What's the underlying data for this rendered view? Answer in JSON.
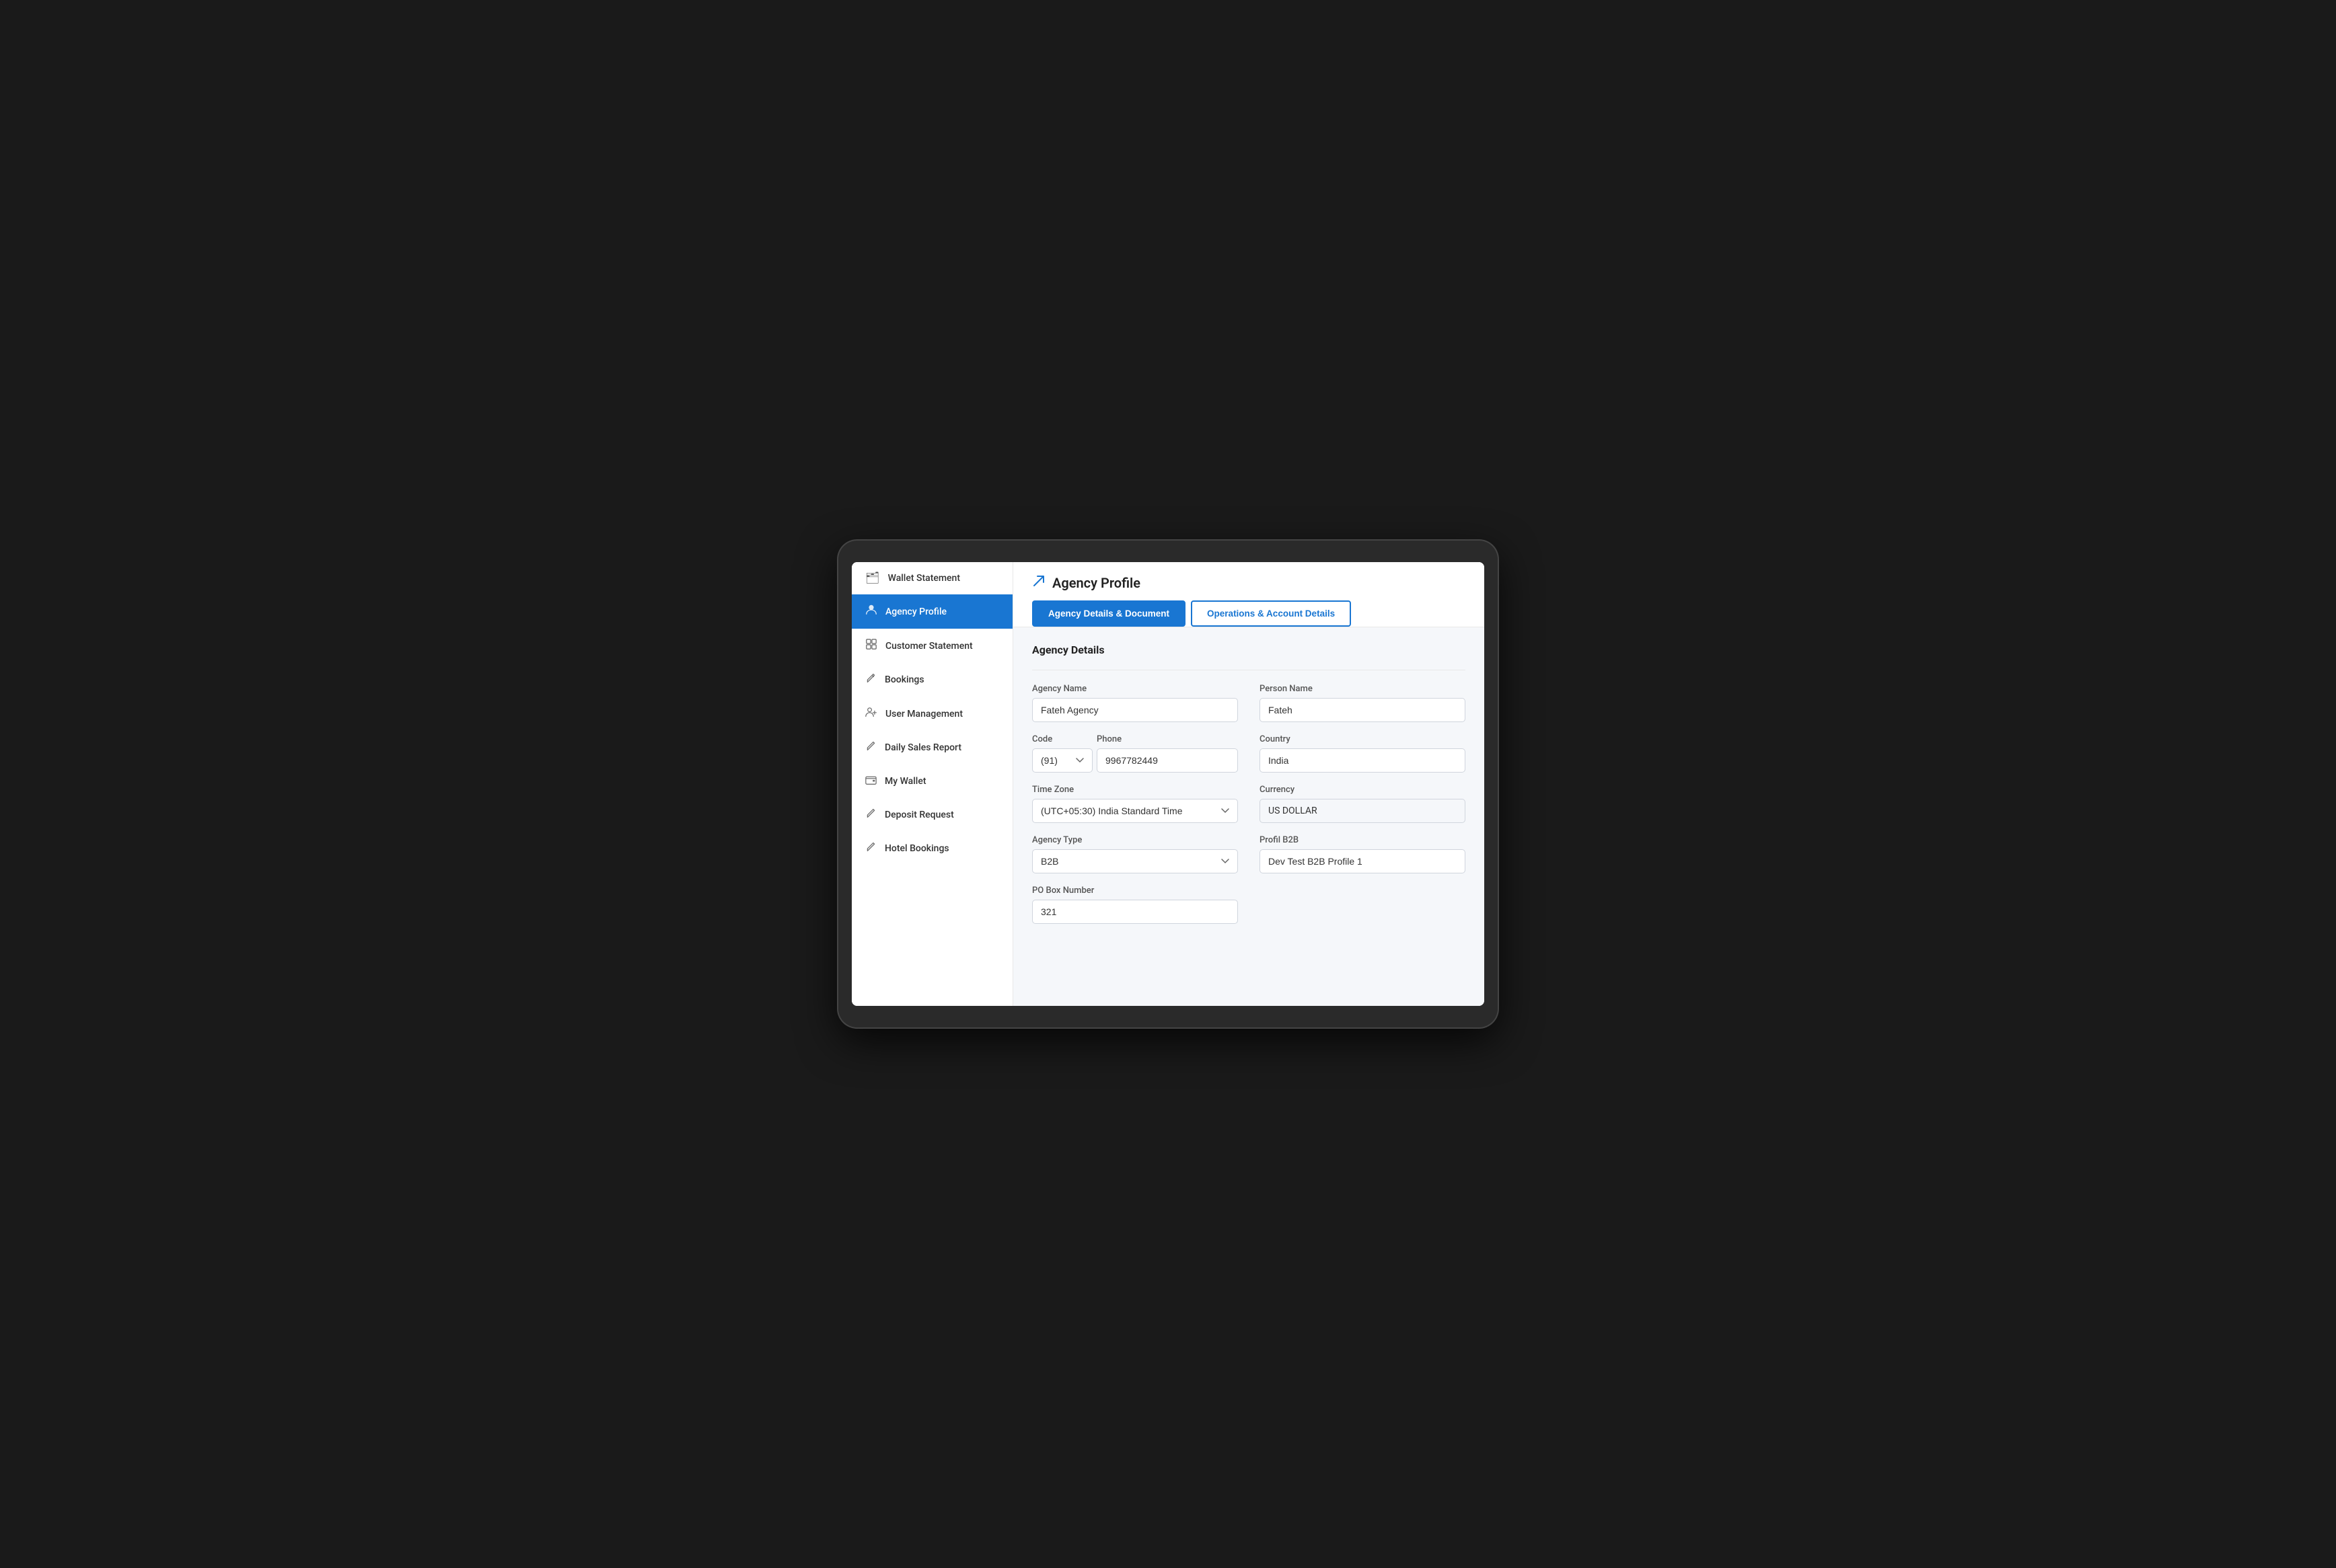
{
  "sidebar": {
    "items": [
      {
        "id": "wallet-statement",
        "label": "Wallet Statement",
        "icon": "🗂",
        "active": false
      },
      {
        "id": "agency-profile",
        "label": "Agency Profile",
        "icon": "👤",
        "active": true
      },
      {
        "id": "customer-statement",
        "label": "Customer Statement",
        "icon": "⊞",
        "active": false
      },
      {
        "id": "bookings",
        "label": "Bookings",
        "icon": "✏️",
        "active": false
      },
      {
        "id": "user-management",
        "label": "User Management",
        "icon": "👥",
        "active": false
      },
      {
        "id": "daily-sales-report",
        "label": "Daily Sales Report",
        "icon": "✏️",
        "active": false
      },
      {
        "id": "my-wallet",
        "label": "My Wallet",
        "icon": "💼",
        "active": false
      },
      {
        "id": "deposit-request",
        "label": "Deposit Request",
        "icon": "✏️",
        "active": false
      },
      {
        "id": "hotel-bookings",
        "label": "Hotel Bookings",
        "icon": "✏️",
        "active": false
      }
    ]
  },
  "header": {
    "title": "Agency Profile",
    "title_icon": "↗"
  },
  "tabs": [
    {
      "id": "agency-details-doc",
      "label": "Agency Details & Document",
      "active": true
    },
    {
      "id": "operations-account",
      "label": "Operations & Account Details",
      "active": false
    }
  ],
  "form": {
    "section_title": "Agency Details",
    "fields": {
      "agency_name_label": "Agency Name",
      "agency_name_value": "Fateh Agency",
      "person_name_label": "Person Name",
      "person_name_value": "Fateh",
      "code_label": "Code",
      "code_value": "(91)",
      "phone_label": "Phone",
      "phone_value": "9967782449",
      "country_label": "Country",
      "country_value": "India",
      "timezone_label": "Time Zone",
      "timezone_value": "(UTC+05:30) India Standard Time",
      "currency_label": "Currency",
      "currency_value": "US DOLLAR",
      "agency_type_label": "Agency Type",
      "agency_type_value": "B2B",
      "profil_b2b_label": "Profil B2B",
      "profil_b2b_value": "Dev Test B2B Profile 1",
      "po_box_label": "PO Box Number",
      "po_box_value": "321"
    }
  }
}
